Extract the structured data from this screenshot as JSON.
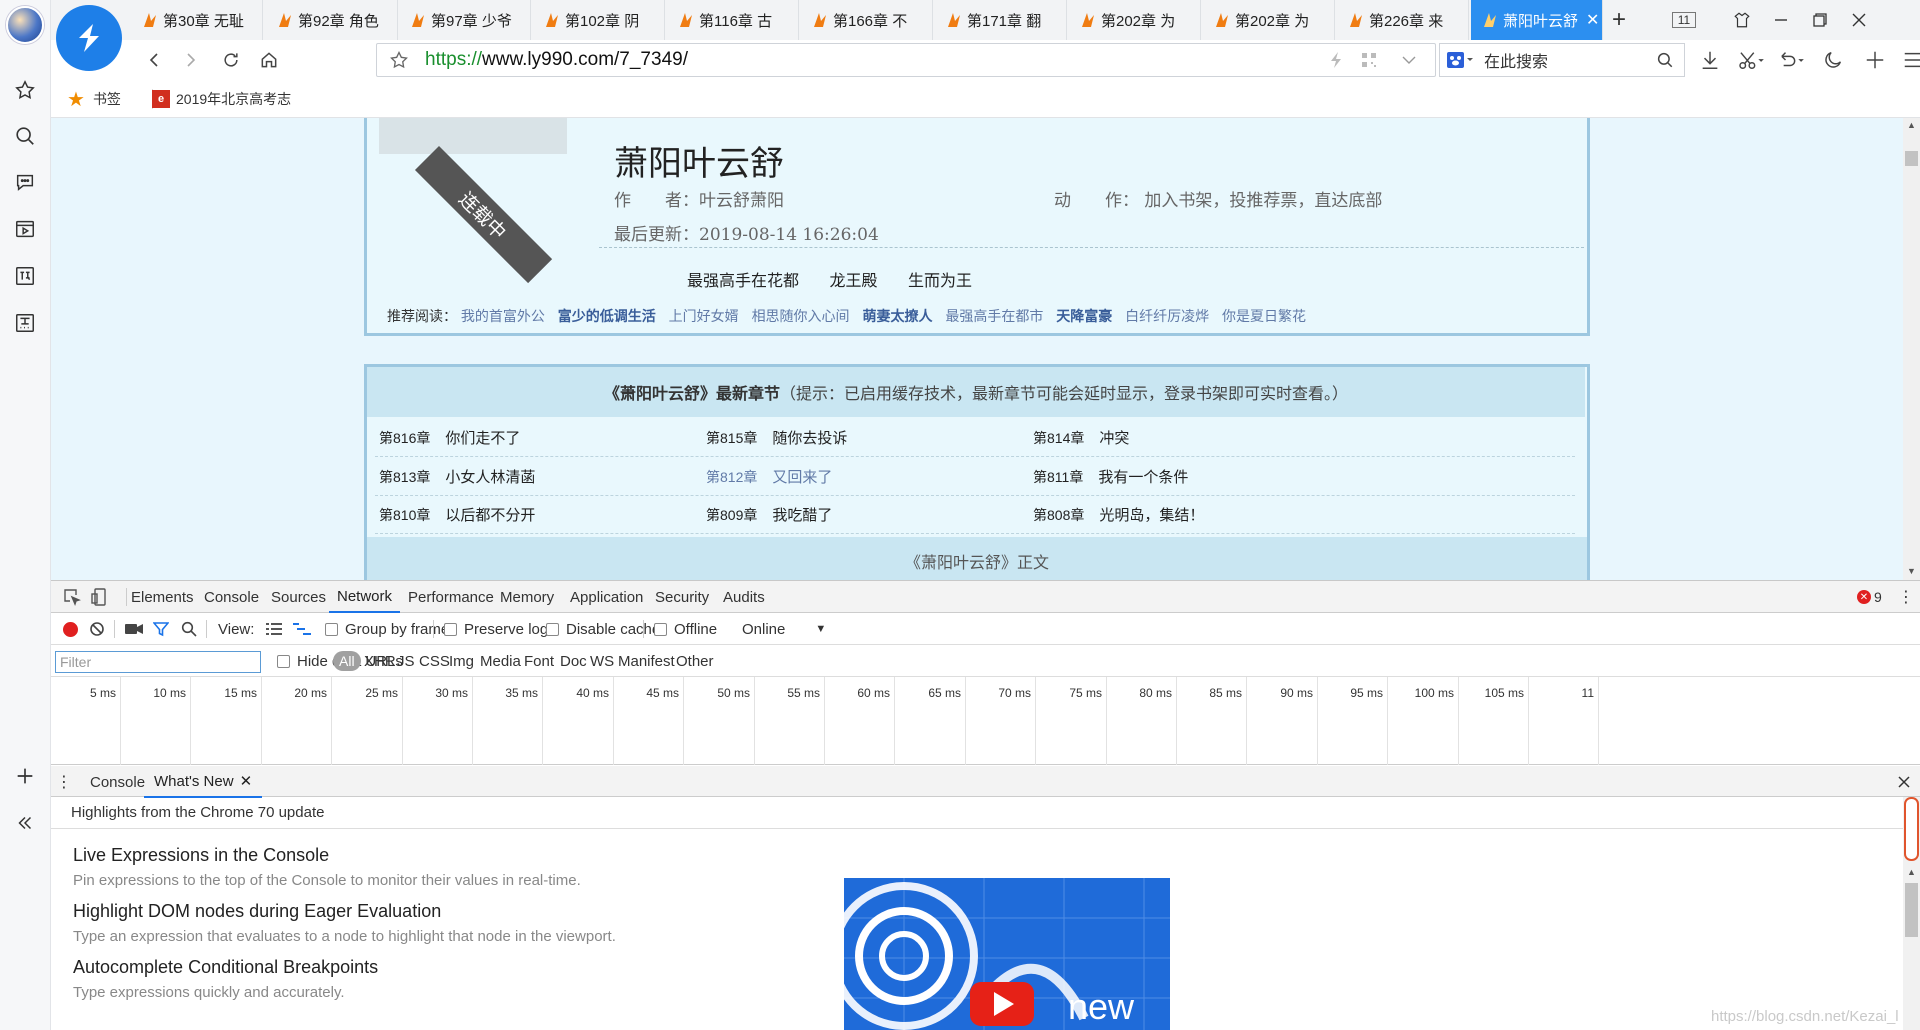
{
  "browser": {
    "tabs": [
      {
        "label": "第30章 无耻"
      },
      {
        "label": "第92章 角色"
      },
      {
        "label": "第97章 少爷"
      },
      {
        "label": "第102章 阴"
      },
      {
        "label": "第116章 古"
      },
      {
        "label": "第166章 不"
      },
      {
        "label": "第171章 翻"
      },
      {
        "label": "第202章 为"
      },
      {
        "label": "第202章 为"
      },
      {
        "label": "第226章 来"
      },
      {
        "label": "萧阳叶云舒"
      }
    ],
    "tab_count": "11",
    "url_proto": "https://",
    "url_rest": "www.ly990.com/7_7349/",
    "search_placeholder": "在此搜索",
    "bookmarks": [
      {
        "label": "书签"
      },
      {
        "label": "2019年北京高考志"
      }
    ]
  },
  "book": {
    "status_ribbon": "连载中",
    "title": "萧阳叶云舒",
    "author_label": "作　　者：",
    "author_value": "叶云舒萧阳",
    "action_label": "动　　作：",
    "actions": [
      "加入书架",
      "投推荐票",
      "直达底部"
    ],
    "updated_label": "最后更新：",
    "updated_value": "2019-08-14 16:26:04",
    "related": [
      "最强高手在花都",
      "龙王殿",
      "生而为王"
    ],
    "recommend_label": "推荐阅读：",
    "recommend": [
      {
        "text": "我的首富外公",
        "bold": false
      },
      {
        "text": "富少的低调生活",
        "bold": true
      },
      {
        "text": "上门好女婿",
        "bold": false
      },
      {
        "text": "相思随你入心间",
        "bold": false
      },
      {
        "text": "萌妻太撩人",
        "bold": true
      },
      {
        "text": "最强高手在都市",
        "bold": false
      },
      {
        "text": "天降富豪",
        "bold": true
      },
      {
        "text": "白纤纤厉凌烨",
        "bold": false
      },
      {
        "text": "你是夏日繁花",
        "bold": false
      }
    ]
  },
  "latest": {
    "heading_title": "《萧阳叶云舒》最新章节",
    "heading_tip": "（提示：已启用缓存技术，最新章节可能会延时显示，登录书架即可实时查看。）",
    "chapters": [
      {
        "no": "第816章",
        "title": "你们走不了",
        "link": false
      },
      {
        "no": "第815章",
        "title": "随你去投诉",
        "link": false
      },
      {
        "no": "第814章",
        "title": "冲突",
        "link": false
      },
      {
        "no": "第813章",
        "title": "小女人林清菡",
        "link": false
      },
      {
        "no": "第812章",
        "title": "又回来了",
        "link": true
      },
      {
        "no": "第811章",
        "title": "我有一个条件",
        "link": false
      },
      {
        "no": "第810章",
        "title": "以后都不分开",
        "link": false
      },
      {
        "no": "第809章",
        "title": "我吃醋了",
        "link": false
      },
      {
        "no": "第808章",
        "title": "光明岛，集结！",
        "link": false
      }
    ],
    "body_heading": "《萧阳叶云舒》正文"
  },
  "devtools": {
    "tabs": [
      "Elements",
      "Console",
      "Sources",
      "Network",
      "Performance",
      "Memory",
      "Application",
      "Security",
      "Audits"
    ],
    "error_count": "9",
    "toolbar": {
      "view_label": "View:",
      "group_by_frame": "Group by frame",
      "preserve_log": "Preserve log",
      "disable_cache": "Disable cache",
      "offline": "Offline",
      "throttle": "Online"
    },
    "filter_placeholder": "Filter",
    "hide_data_urls": "Hide data URLs",
    "types": [
      "All",
      "XHR",
      "JS",
      "CSS",
      "Img",
      "Media",
      "Font",
      "Doc",
      "WS",
      "Manifest",
      "Other"
    ],
    "ticks": [
      "5 ms",
      "10 ms",
      "15 ms",
      "20 ms",
      "25 ms",
      "30 ms",
      "35 ms",
      "40 ms",
      "45 ms",
      "50 ms",
      "55 ms",
      "60 ms",
      "65 ms",
      "70 ms",
      "75 ms",
      "80 ms",
      "85 ms",
      "90 ms",
      "95 ms",
      "100 ms",
      "105 ms",
      "11"
    ],
    "drawer_tabs": [
      "Console",
      "What's New"
    ],
    "whats_new_heading": "Highlights from the Chrome 70 update",
    "features": [
      {
        "title": "Live Expressions in the Console",
        "desc": "Pin expressions to the top of the Console to monitor their values in real-time."
      },
      {
        "title": "Highlight DOM nodes during Eager Evaluation",
        "desc": "Type an expression that evaluates to a node to highlight that node in the viewport."
      },
      {
        "title": "Autocomplete Conditional Breakpoints",
        "desc": "Type expressions quickly and accurately."
      }
    ],
    "video_text": "new",
    "watermark": "https://blog.csdn.net/Kezai_l"
  },
  "colors": {
    "accent": "#2c8ff0",
    "link": "#617aa7",
    "page_bg": "#e8f6fd",
    "record": "#e02020"
  }
}
